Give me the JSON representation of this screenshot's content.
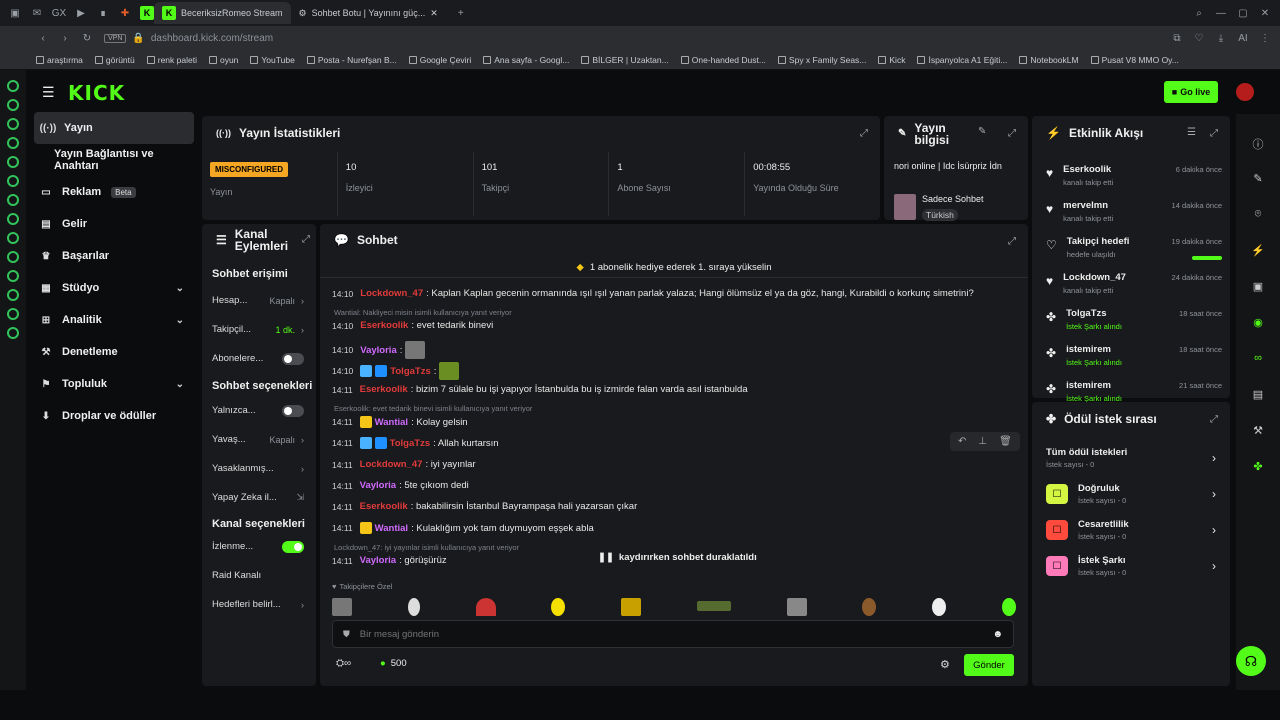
{
  "browser": {
    "tabs": [
      {
        "label": "BeceriksizRomeo Stream"
      },
      {
        "label": "Sohbet Botu | Yayınını güç..."
      }
    ],
    "url": "dashboard.kick.com/stream",
    "bookmarks": [
      "araştırma",
      "görüntü",
      "renk paleti",
      "oyun",
      "YouTube",
      "Posta - Nurefşan B...",
      "Google Çeviri",
      "Ana sayfa - Googl...",
      "BİLGER | Uzaktan...",
      "One-handed Dust...",
      "Spy x Family Seas...",
      "Kick",
      "İspanyolca A1 Eğiti...",
      "NotebookLM",
      "Pusat V8 MMO Oy..."
    ]
  },
  "header": {
    "logo": "KICK",
    "go_live": "Go live"
  },
  "sidebar": {
    "items": [
      {
        "label": "Yayın",
        "icon": "broadcast-icon"
      },
      {
        "label": "Yayın Bağlantısı ve Anahtarı"
      },
      {
        "label": "Reklam",
        "badge": "Beta",
        "icon": "ad-icon"
      },
      {
        "label": "Gelir",
        "icon": "revenue-icon"
      },
      {
        "label": "Başarılar",
        "icon": "trophy-icon"
      },
      {
        "label": "Stüdyo",
        "icon": "studio-icon"
      },
      {
        "label": "Analitik",
        "icon": "analytics-icon"
      },
      {
        "label": "Denetleme",
        "icon": "moderation-icon"
      },
      {
        "label": "Topluluk",
        "icon": "community-icon"
      },
      {
        "label": "Droplar ve ödüller",
        "icon": "drops-icon"
      }
    ]
  },
  "stats": {
    "title": "Yayın İstatistikleri",
    "status_badge": "MISCONFIGURED",
    "status_label": "Yayın",
    "items": [
      {
        "value": "10",
        "label": "İzleyici"
      },
      {
        "value": "101",
        "label": "Takipçi"
      },
      {
        "value": "1",
        "label": "Abone Sayısı"
      },
      {
        "value": "00:08:55",
        "label": "Yayında Olduğu Süre"
      }
    ]
  },
  "stream_info": {
    "title": "Yayın bilgisi",
    "stream_title": "nori online | Idc İsürpriz İdn",
    "category": "Sadece Sohbet",
    "tag": "Türkish"
  },
  "events": {
    "title": "Etkinlik Akışı",
    "items": [
      {
        "name": "Eserkoolik",
        "desc": "kanalı takip etti",
        "time": "6 dakika önce"
      },
      {
        "name": "mervelmn",
        "desc": "kanalı takip etti",
        "time": "14 dakika önce"
      },
      {
        "name": "Takipçi hedefi",
        "desc": "hedefe ulaşıldı",
        "time": "19 dakika önce"
      },
      {
        "name": "Lockdown_47",
        "desc": "kanalı takip etti",
        "time": "24 dakika önce"
      },
      {
        "name": "TolgaTzs",
        "desc": "İstek Şarkı alındı",
        "time": "18 saat önce"
      },
      {
        "name": "istemirem",
        "desc": "İstek Şarkı alındı",
        "time": "18 saat önce"
      },
      {
        "name": "istemirem",
        "desc": "İstek Şarkı alındı",
        "time": "21 saat önce"
      }
    ]
  },
  "queue": {
    "title": "Ödül istek sırası",
    "items": [
      {
        "name": "Tüm ödül istekleri",
        "desc": "İstek sayısı - 0",
        "color": ""
      },
      {
        "name": "Doğruluk",
        "desc": "İstek sayısı - 0",
        "color": "#d4f542"
      },
      {
        "name": "Cesaretlilik",
        "desc": "İstek sayısı - 0",
        "color": "#ff4b3e"
      },
      {
        "name": "İstek Şarkı",
        "desc": "İstek sayısı - 0",
        "color": "#ff7ab8"
      }
    ]
  },
  "actions": {
    "title": "Kanal Eylemleri",
    "group1": "Sohbet erişimi",
    "rows1": [
      {
        "label": "Hesap...",
        "value": "Kapalı"
      },
      {
        "label": "Takipçil...",
        "value": "1 dk."
      },
      {
        "label": "Abonelere..."
      }
    ],
    "group2": "Sohbet seçenekleri",
    "rows2": [
      {
        "label": "Yalnızca..."
      },
      {
        "label": "Yavaş...",
        "value": "Kapalı"
      },
      {
        "label": "Yasaklanmış..."
      },
      {
        "label": "Yapay Zeka il..."
      }
    ],
    "group3": "Kanal seçenekleri",
    "rows3": [
      {
        "label": "İzlenme..."
      },
      {
        "label": "Raid Kanalı"
      },
      {
        "label": "Hedefleri belirl..."
      }
    ]
  },
  "chat": {
    "title": "Sohbet",
    "banner": "1 abonelik hediye ederek 1. sıraya yükselin",
    "messages": [
      {
        "time": "14:10",
        "user": "Lockdown_47",
        "color": "#e23b3b",
        "text": ": Kaplan Kaplan gecenin ormanında ışıl ışıl yanan parlak yalaza; Hangi ölümsüz el ya da göz, hangi, Kurabildi o korkunç simetrini?"
      },
      {
        "reply": "Wantial: Nakliyeci misin isimli kullanıcıya yanıt veriyor"
      },
      {
        "time": "14:10",
        "user": "Eserkoolik",
        "color": "#e23b3b",
        "text": ": evet tedarik binevi"
      },
      {
        "time": "14:10",
        "user": "Vayloria",
        "color": "#d06bff",
        "text": ":"
      },
      {
        "time": "14:10",
        "user": "TolgaTzs",
        "color": "#e23b3b",
        "text": ":"
      },
      {
        "time": "14:11",
        "user": "Eserkoolik",
        "color": "#e23b3b",
        "text": ": bizim 7 sülale bu işi yapıyor İstanbulda bu iş izmirde falan varda asıl istanbulda"
      },
      {
        "reply": "Eserkoolik: evet tedarik binevi isimli kullanıcıya yanıt veriyor"
      },
      {
        "time": "14:11",
        "user": "Wantial",
        "color": "#d06bff",
        "text": ": Kolay gelsin"
      },
      {
        "time": "14:11",
        "user": "TolgaTzs",
        "color": "#e23b3b",
        "text": ": Allah kurtarsın"
      },
      {
        "time": "14:11",
        "user": "Lockdown_47",
        "color": "#e23b3b",
        "text": ": iyi yayınlar"
      },
      {
        "time": "14:11",
        "user": "Vayloria",
        "color": "#d06bff",
        "text": ": 5te çıkıom dedi"
      },
      {
        "time": "14:11",
        "user": "Eserkoolik",
        "color": "#e23b3b",
        "text": ": bakabilirsin İstanbul Bayrampaşa hali yazarsan çıkar"
      },
      {
        "time": "14:11",
        "user": "Wantial",
        "color": "#d06bff",
        "text": ": Kulaklığım yok tam duymuyom eşşek abla"
      },
      {
        "reply": "Lockdown_47: iyi yayınlar isimli kullanıcıya yanıt veriyor"
      },
      {
        "time": "14:11",
        "user": "Vayloria",
        "color": "#d06bff",
        "text": ": görüşürüz"
      }
    ],
    "paused": "kaydırırken sohbet duraklatıldı",
    "followers_only": "Takipçilere Özel",
    "placeholder": "Bir mesaj gönderin",
    "points": "500",
    "send": "Gönder"
  }
}
